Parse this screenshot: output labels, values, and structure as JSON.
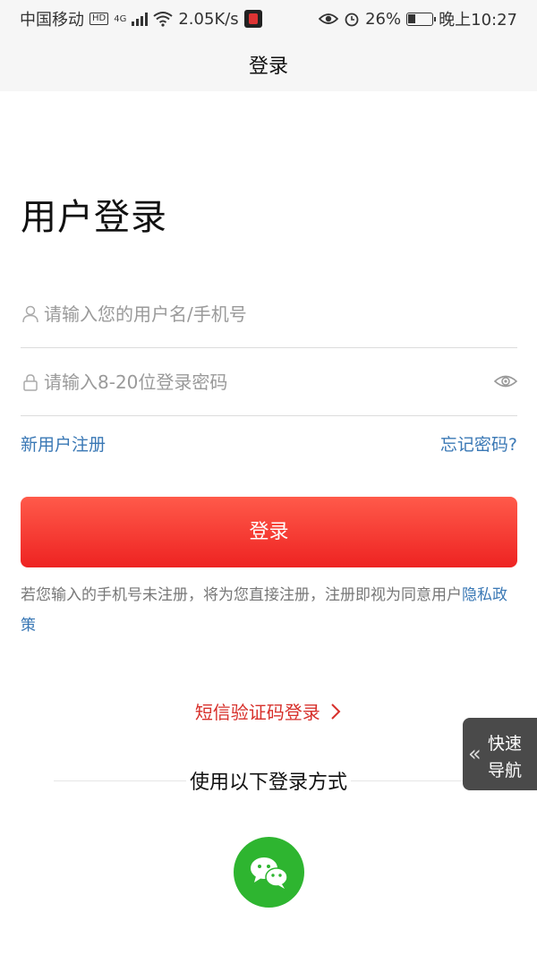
{
  "status_bar": {
    "carrier": "中国移动",
    "hd": "HD",
    "net_type": "4G",
    "speed": "2.05K/s",
    "battery": "26%",
    "time": "晚上10:27"
  },
  "nav": {
    "title": "登录"
  },
  "page": {
    "title": "用户登录"
  },
  "form": {
    "username_placeholder": "请输入您的用户名/手机号",
    "password_placeholder": "请输入8-20位登录密码",
    "register_link": "新用户注册",
    "forgot_link": "忘记密码?",
    "submit_label": "登录"
  },
  "notice": {
    "text": "若您输入的手机号未注册，将为您直接注册，注册即视为同意用户",
    "policy_link": "隐私政策"
  },
  "sms_login": {
    "label": "短信验证码登录"
  },
  "other_login": {
    "title": "使用以下登录方式"
  },
  "quick_nav": {
    "line1": "快速",
    "line2": "导航"
  },
  "colors": {
    "accent_red": "#ee2322",
    "link_blue": "#3a78b5",
    "wechat_green": "#2eb530"
  }
}
